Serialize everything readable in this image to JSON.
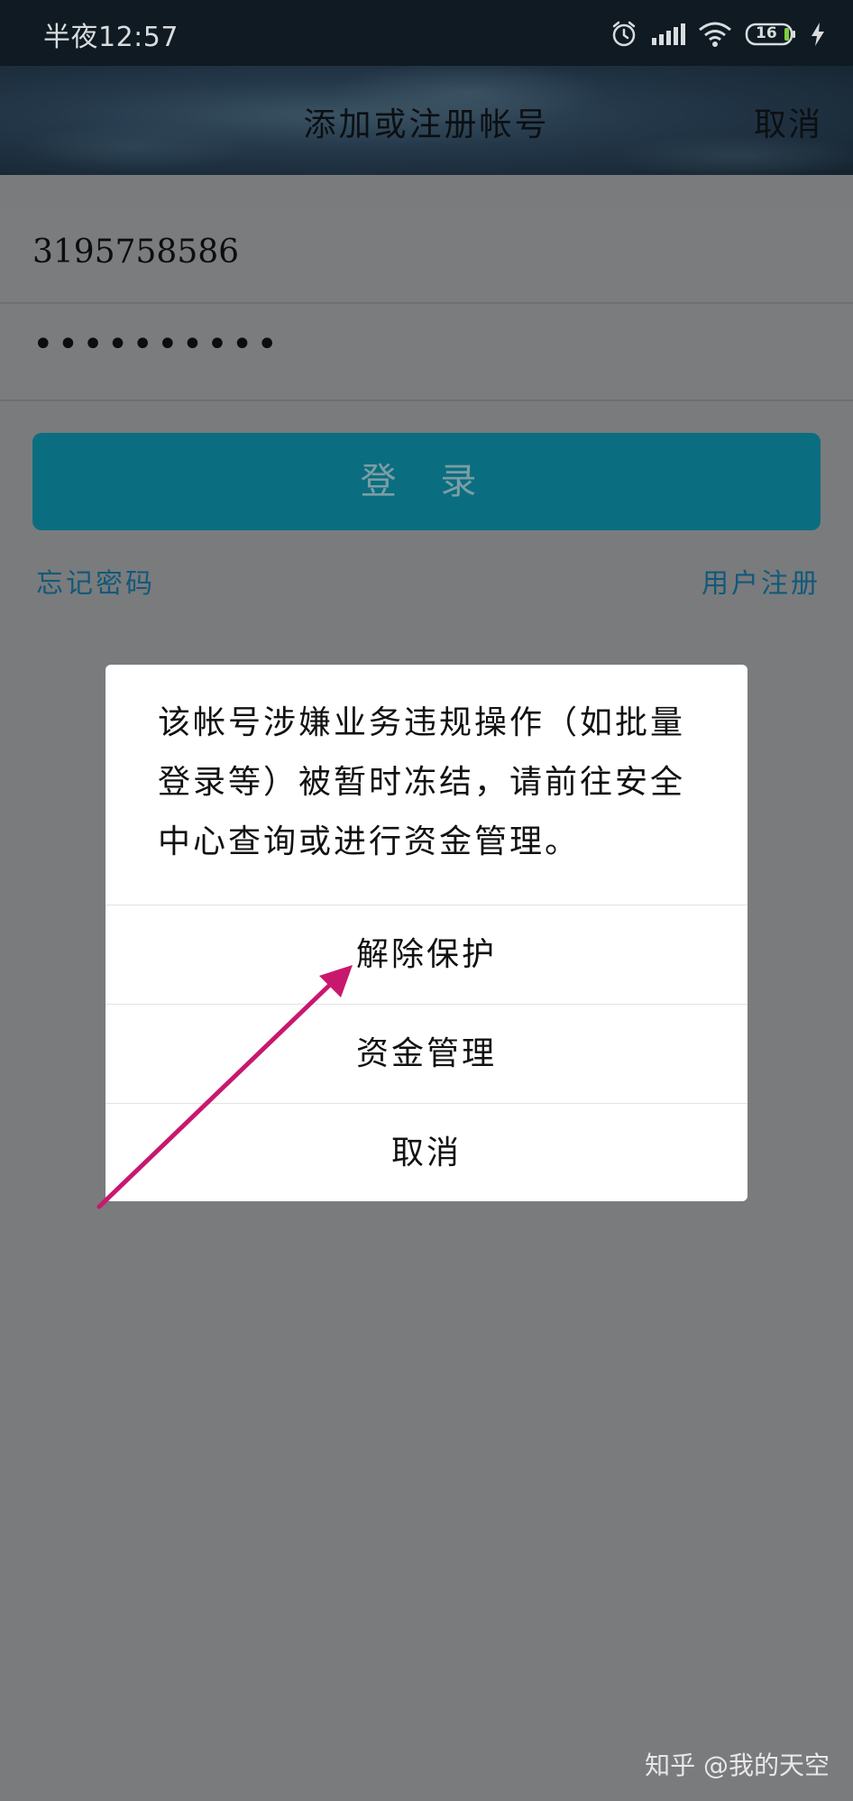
{
  "status_bar": {
    "time": "半夜12:57",
    "battery": "16",
    "icons": [
      "alarm-icon",
      "signal-icon",
      "wifi-icon",
      "battery-icon",
      "charging-icon"
    ]
  },
  "title_bar": {
    "title": "添加或注册帐号",
    "cancel_label": "取消"
  },
  "login_form": {
    "account_value": "3195758586",
    "password_mask": "••••••••••",
    "login_button_label": "登 录",
    "forgot_password_label": "忘记密码",
    "register_label": "用户注册"
  },
  "dialog": {
    "message": "该帐号涉嫌业务违规操作（如批量登录等）被暂时冻结，请前往安全中心查询或进行资金管理。",
    "options": [
      {
        "label": "解除保护"
      },
      {
        "label": "资金管理"
      },
      {
        "label": "取消"
      }
    ]
  },
  "watermark": "知乎 @我的天空",
  "colors": {
    "status_bar_bg": "#0f1a22",
    "overlay_bg": "#7a7b7d",
    "login_button": "#0b6e80",
    "link": "#11597a",
    "annotation_arrow": "#c8186e"
  }
}
